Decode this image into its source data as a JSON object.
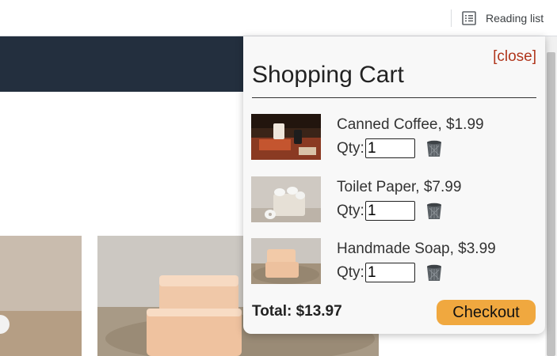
{
  "browser": {
    "reading_list_label": "Reading list"
  },
  "page": {
    "header_color": "#232f3e"
  },
  "cart": {
    "close_label": "[close]",
    "title": "Shopping Cart",
    "qty_label": "Qty:",
    "items": [
      {
        "name": "Canned Coffee, $1.99",
        "qty": "1"
      },
      {
        "name": "Toilet Paper, $7.99",
        "qty": "1"
      },
      {
        "name": "Handmade Soap, $3.99",
        "qty": "1"
      }
    ],
    "total_label": "Total: $13.97",
    "checkout_label": "Checkout",
    "accent_color": "#f0a83f",
    "close_color": "#b0361c"
  }
}
